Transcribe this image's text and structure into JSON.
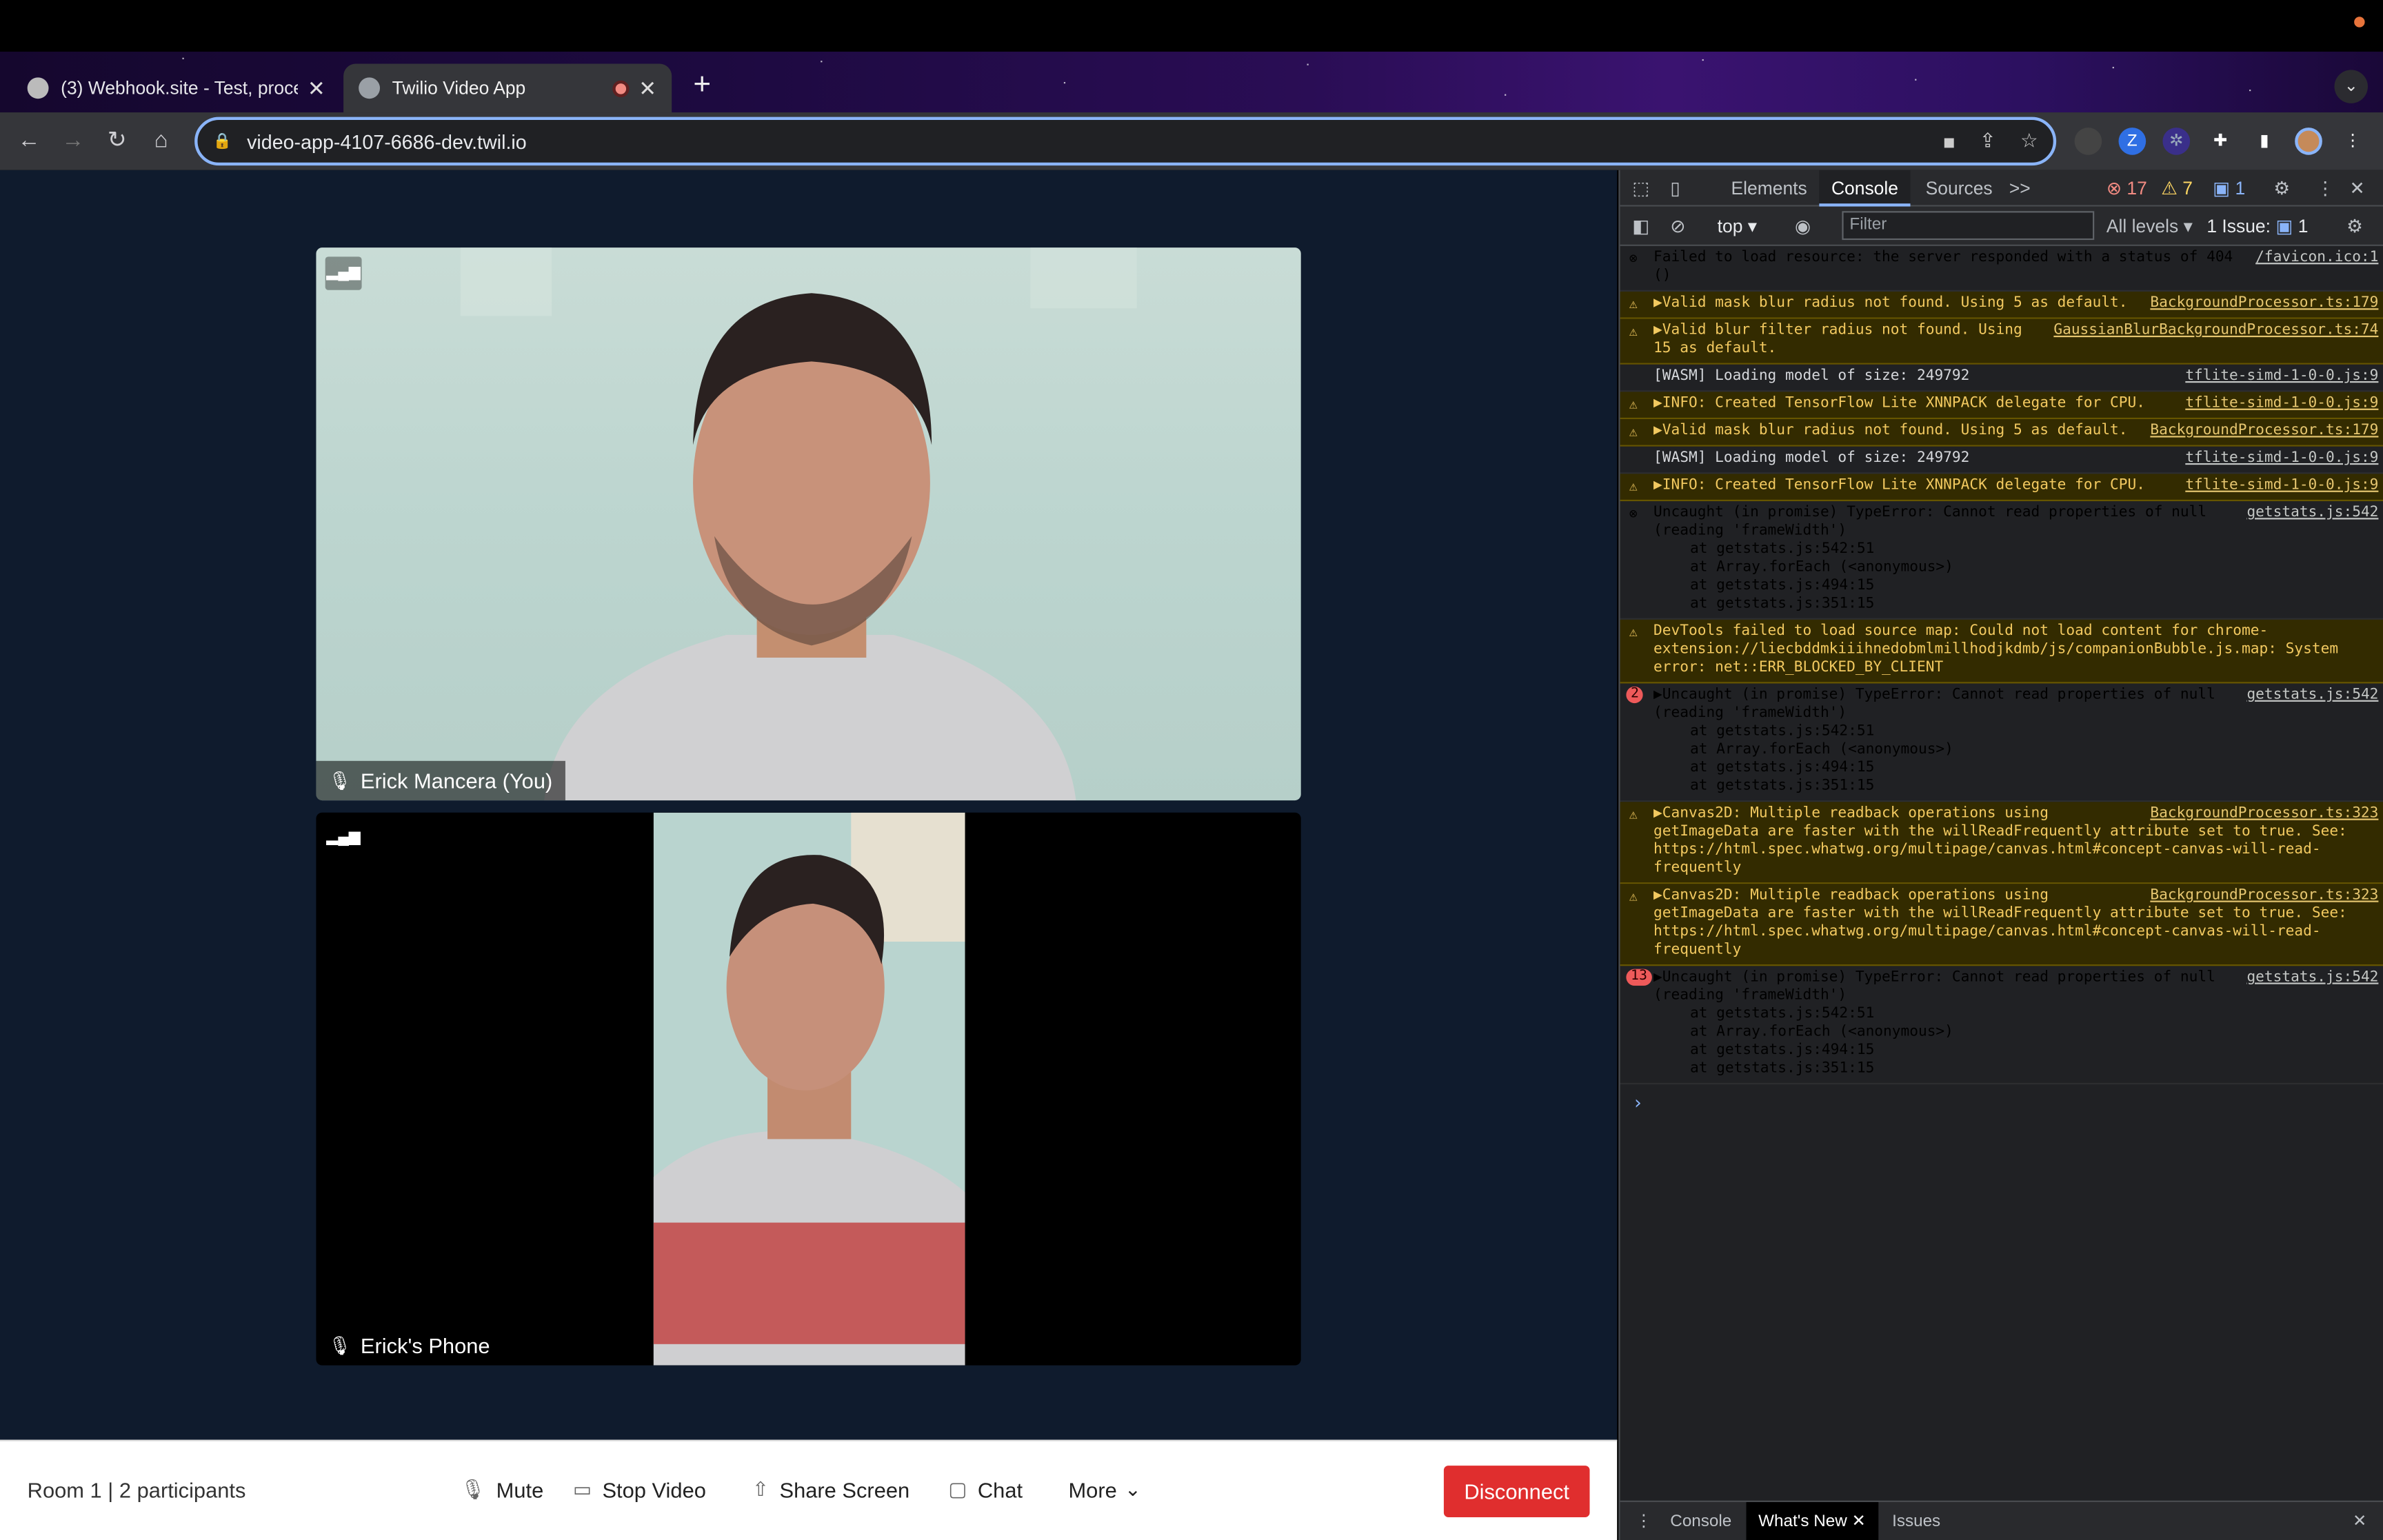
{
  "browser": {
    "tabs": [
      {
        "title": "(3) Webhook.site - Test, proce",
        "active": false
      },
      {
        "title": "Twilio Video App",
        "active": true
      }
    ],
    "url": "video-app-4107-6686-dev.twil.io"
  },
  "video": {
    "participants": [
      {
        "name": "Erick Mancera (You)"
      },
      {
        "name": "Erick's Phone"
      }
    ]
  },
  "footer": {
    "room_info": "Room 1 | 2 participants",
    "mute_label": "Mute",
    "stop_video_label": "Stop Video",
    "share_screen_label": "Share Screen",
    "chat_label": "Chat",
    "more_label": "More",
    "disconnect_label": "Disconnect"
  },
  "devtools": {
    "tabs": [
      "Elements",
      "Console",
      "Sources"
    ],
    "more_tabs": ">>",
    "error_count": "17",
    "warning_count": "7",
    "info_count": "1",
    "context": "top",
    "filter_placeholder": "Filter",
    "levels": "All levels",
    "issues": "1 Issue:",
    "issues_count": "1",
    "messages": [
      {
        "type": "error",
        "text": "Failed to load resource: the server responded with a status of 404 ()",
        "source": "/favicon.ico:1"
      },
      {
        "type": "warn",
        "text": "▶Valid mask blur radius not found. Using 5 as default.",
        "source": "BackgroundProcessor.ts:179"
      },
      {
        "type": "warn",
        "text": "▶Valid blur filter radius not found. Using 15 as default.",
        "source": "GaussianBlurBackgroundProcessor.ts:74"
      },
      {
        "type": "info",
        "text": "[WASM] Loading model of size: 249792",
        "source": "tflite-simd-1-0-0.js:9"
      },
      {
        "type": "warn",
        "text": "▶INFO: Created TensorFlow Lite XNNPACK delegate for CPU.",
        "source": "tflite-simd-1-0-0.js:9"
      },
      {
        "type": "warn",
        "text": "▶Valid mask blur radius not found. Using 5 as default.",
        "source": "BackgroundProcessor.ts:179"
      },
      {
        "type": "info",
        "text": "[WASM] Loading model of size: 249792",
        "source": "tflite-simd-1-0-0.js:9"
      },
      {
        "type": "warn",
        "text": "▶INFO: Created TensorFlow Lite XNNPACK delegate for CPU.",
        "source": "tflite-simd-1-0-0.js:9"
      },
      {
        "type": "error",
        "text": "Uncaught (in promise) TypeError: Cannot read properties of null (reading 'frameWidth')",
        "source": "getstats.js:542"
      },
      {
        "type": "warn",
        "text": "DevTools failed to load source map: Could not load content for chrome-extension://liecbddmkiiihnedobmlmillhodjkdmb/js/companionBubble.js.map: System error: net::ERR_BLOCKED_BY_CLIENT",
        "source": ""
      },
      {
        "type": "error",
        "count": "2",
        "text": "▶Uncaught (in promise) TypeError: Cannot read properties of null (reading 'frameWidth')",
        "source": "getstats.js:542"
      },
      {
        "type": "warn",
        "text": "▶Canvas2D: Multiple readback operations using getImageData are faster with the willReadFrequently attribute set to true. See: https://html.spec.whatwg.org/multipage/canvas.html#concept-canvas-will-read-frequently",
        "source": "BackgroundProcessor.ts:323"
      },
      {
        "type": "warn",
        "text": "▶Canvas2D: Multiple readback operations using getImageData are faster with the willReadFrequently attribute set to true. See: https://html.spec.whatwg.org/multipage/canvas.html#concept-canvas-will-read-frequently",
        "source": "BackgroundProcessor.ts:323"
      },
      {
        "type": "error",
        "count": "13",
        "text": "▶Uncaught (in promise) TypeError: Cannot read properties of null (reading 'frameWidth')",
        "source": "getstats.js:542"
      }
    ],
    "stack": [
      "at getstats.js:542:51",
      "at Array.forEach (<anonymous>)",
      "at getstats.js:494:15",
      "at getstats.js:351:15"
    ],
    "drawer_tabs": [
      "Console",
      "What's New",
      "Issues"
    ]
  },
  "colors": {
    "accent": "#8ab4f8",
    "disconnect": "#e02e2e",
    "app_bg": "#0f1b2d"
  }
}
